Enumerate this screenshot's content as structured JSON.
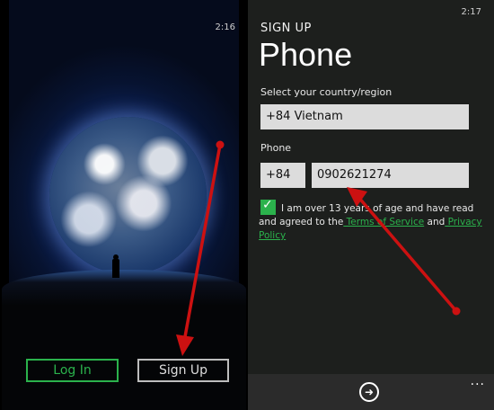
{
  "left_screen": {
    "clock": "2:16",
    "login_label": "Log In",
    "signup_label": "Sign Up"
  },
  "right_screen": {
    "clock": "2:17",
    "header_small": "SIGN UP",
    "header_big": "Phone",
    "country_label": "Select your country/region",
    "country_value": "+84 Vietnam",
    "phone_label": "Phone",
    "country_code": "+84",
    "phone_number": "0902621274",
    "terms_prefix": "I am over 13 years of age and have read and agreed to the",
    "terms_link": " Terms of Service",
    "terms_and": " and",
    "privacy_link": " Privacy Policy",
    "more_label": "..."
  },
  "colors": {
    "accent": "#2bb24c",
    "annotation_arrow": "#cc1111"
  },
  "icons": {
    "next": "arrow-right-circle-icon",
    "check": "checkmark-icon",
    "more": "ellipsis-icon"
  }
}
